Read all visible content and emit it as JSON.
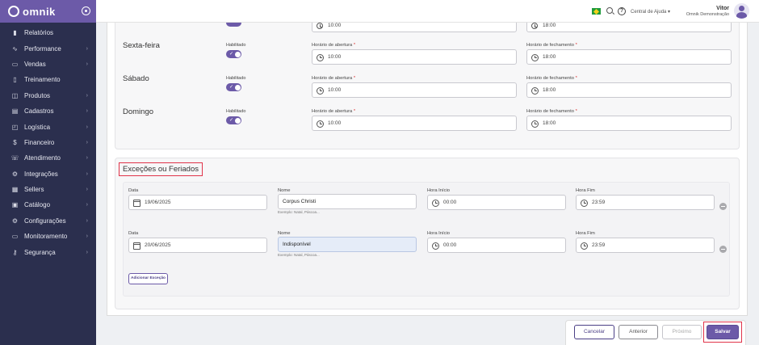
{
  "brand": {
    "name": "omnik"
  },
  "sidebar": {
    "items": [
      {
        "label": "Relatórios",
        "icon": "bar-chart-icon",
        "has_chevron": false
      },
      {
        "label": "Performance",
        "icon": "pulse-icon",
        "has_chevron": true
      },
      {
        "label": "Vendas",
        "icon": "cart-icon",
        "has_chevron": true
      },
      {
        "label": "Treinamento",
        "icon": "book-icon",
        "has_chevron": false
      },
      {
        "label": "Produtos",
        "icon": "box-icon",
        "has_chevron": true
      },
      {
        "label": "Cadastros",
        "icon": "form-icon",
        "has_chevron": true
      },
      {
        "label": "Logística",
        "icon": "truck-icon",
        "has_chevron": true
      },
      {
        "label": "Financeiro",
        "icon": "dollar-icon",
        "has_chevron": true
      },
      {
        "label": "Atendimento",
        "icon": "phone-icon",
        "has_chevron": true
      },
      {
        "label": "Integrações",
        "icon": "integration-icon",
        "has_chevron": true
      },
      {
        "label": "Sellers",
        "icon": "sellers-icon",
        "has_chevron": true
      },
      {
        "label": "Catálogo",
        "icon": "catalog-icon",
        "has_chevron": true
      },
      {
        "label": "Configurações",
        "icon": "gear-icon",
        "has_chevron": true
      },
      {
        "label": "Monitoramento",
        "icon": "monitor-icon",
        "has_chevron": true
      },
      {
        "label": "Segurança",
        "icon": "key-icon",
        "has_chevron": true
      }
    ]
  },
  "topbar": {
    "help_label": "Central de Ajuda ▾",
    "user_name": "Vitor",
    "user_org": "Omnik Demonstração"
  },
  "hours": {
    "previous_row": {
      "open": "10:00",
      "close": "18:00"
    },
    "enabled_label": "Habilitado",
    "open_label": "Horário de abertura",
    "close_label": "Horário de fechamento",
    "required_mark": "*",
    "days": [
      {
        "name": "Sexta-feira",
        "open": "10:00",
        "close": "18:00"
      },
      {
        "name": "Sábado",
        "open": "10:00",
        "close": "18:00"
      },
      {
        "name": "Domingo",
        "open": "10:00",
        "close": "18:00"
      }
    ]
  },
  "exceptions": {
    "title": "Exceções ou Feriados",
    "labels": {
      "date": "Data",
      "name": "Nome",
      "start": "Hora Início",
      "end": "Hora Fim"
    },
    "hint": "Exemplo: Natal, Páscoa...",
    "rows": [
      {
        "date": "19/06/2025",
        "name": "Corpus Christi",
        "start": "00:00",
        "end": "23:59"
      },
      {
        "date": "20/06/2025",
        "name": "Indisponível",
        "start": "00:00",
        "end": "23:59"
      }
    ],
    "add_label": "Adicionar Exceção"
  },
  "footer": {
    "cancel": "Cancelar",
    "previous": "Anterior",
    "next": "Próximo",
    "save": "Salvar"
  },
  "colors": {
    "accent": "#6c5aa8",
    "sidebar_bg": "#2b2f4e",
    "highlight": "#e0344a"
  }
}
